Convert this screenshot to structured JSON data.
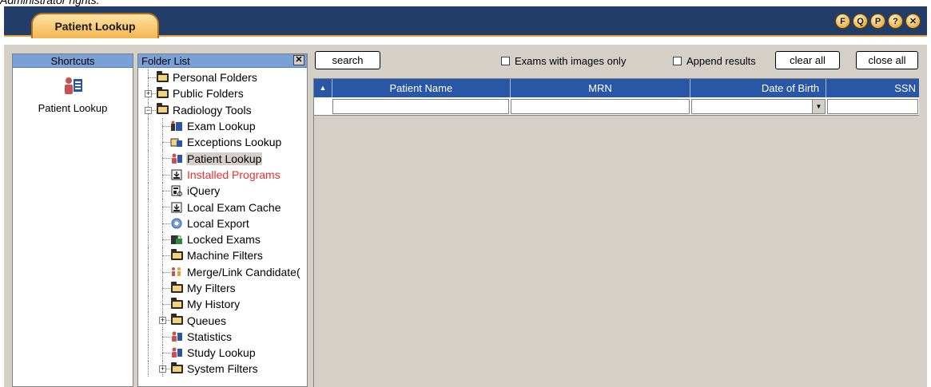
{
  "caption": "Administrator rights.",
  "app": {
    "title_tab": "Patient Lookup",
    "header_buttons": [
      {
        "letter": "F",
        "icon": "f-circle-icon"
      },
      {
        "letter": "Q",
        "icon": "q-circle-icon"
      },
      {
        "letter": "P",
        "icon": "p-circle-icon"
      },
      {
        "letter": "?",
        "icon": "help-circle-icon"
      },
      {
        "letter": "✕",
        "icon": "close-circle-icon"
      }
    ]
  },
  "shortcuts": {
    "header": "Shortcuts",
    "items": [
      {
        "label": "Patient Lookup",
        "icon": "patient-lookup-icon"
      }
    ]
  },
  "folder_list": {
    "header": "Folder List",
    "close_label": "✕",
    "items": [
      {
        "label": "Personal Folders",
        "level": 0,
        "icon": "folder-icon",
        "expander": "",
        "state": "normal"
      },
      {
        "label": "Public Folders",
        "level": 0,
        "icon": "folder-icon",
        "expander": "+",
        "state": "normal"
      },
      {
        "label": "Radiology Tools",
        "level": 0,
        "icon": "folder-icon",
        "expander": "−",
        "state": "normal"
      },
      {
        "label": "Exam Lookup",
        "level": 1,
        "icon": "exam-lookup-icon",
        "expander": "",
        "state": "normal"
      },
      {
        "label": "Exceptions Lookup",
        "level": 1,
        "icon": "exceptions-lookup-icon",
        "expander": "",
        "state": "normal"
      },
      {
        "label": "Patient Lookup",
        "level": 1,
        "icon": "patient-lookup-icon",
        "expander": "",
        "state": "selected"
      },
      {
        "label": "Installed Programs",
        "level": 1,
        "icon": "installed-programs-icon",
        "expander": "",
        "state": "red"
      },
      {
        "label": "iQuery",
        "level": 1,
        "icon": "iquery-icon",
        "expander": "",
        "state": "normal"
      },
      {
        "label": "Local Exam Cache",
        "level": 1,
        "icon": "local-exam-cache-icon",
        "expander": "",
        "state": "normal"
      },
      {
        "label": "Local Export",
        "level": 1,
        "icon": "local-export-icon",
        "expander": "",
        "state": "normal"
      },
      {
        "label": "Locked Exams",
        "level": 1,
        "icon": "locked-exams-icon",
        "expander": "",
        "state": "normal"
      },
      {
        "label": "Machine Filters",
        "level": 1,
        "icon": "folder-icon",
        "expander": "",
        "state": "normal"
      },
      {
        "label": "Merge/Link Candidate(",
        "level": 1,
        "icon": "merge-link-icon",
        "expander": "",
        "state": "normal"
      },
      {
        "label": "My Filters",
        "level": 1,
        "icon": "folder-icon",
        "expander": "",
        "state": "normal"
      },
      {
        "label": "My History",
        "level": 1,
        "icon": "folder-icon",
        "expander": "",
        "state": "normal"
      },
      {
        "label": "Queues",
        "level": 1,
        "icon": "folder-icon",
        "expander": "+",
        "state": "normal"
      },
      {
        "label": "Statistics",
        "level": 1,
        "icon": "statistics-icon",
        "expander": "",
        "state": "normal"
      },
      {
        "label": "Study Lookup",
        "level": 1,
        "icon": "study-lookup-icon",
        "expander": "",
        "state": "normal"
      },
      {
        "label": "System Filters",
        "level": 1,
        "icon": "folder-icon",
        "expander": "+",
        "state": "normal"
      }
    ]
  },
  "toolbar": {
    "search_label": "search",
    "exams_with_images_label": "Exams with images only",
    "append_results_label": "Append results",
    "clear_all_label": "clear all",
    "close_all_label": "close all"
  },
  "grid": {
    "sort_indicator": "▲",
    "columns": [
      {
        "label": "Patient Name",
        "align": "center"
      },
      {
        "label": "MRN",
        "align": "center"
      },
      {
        "label": "Date of Birth",
        "align": "right"
      },
      {
        "label": "SSN",
        "align": "right"
      }
    ],
    "filter_values": [
      "",
      "",
      "",
      ""
    ]
  },
  "colors": {
    "titlebar": "#223e68",
    "tab_accent": "#f4b550",
    "panel_header": "#7aa0d8",
    "grid_header": "#2a56a6",
    "installed_programs_text": "#e83030"
  }
}
